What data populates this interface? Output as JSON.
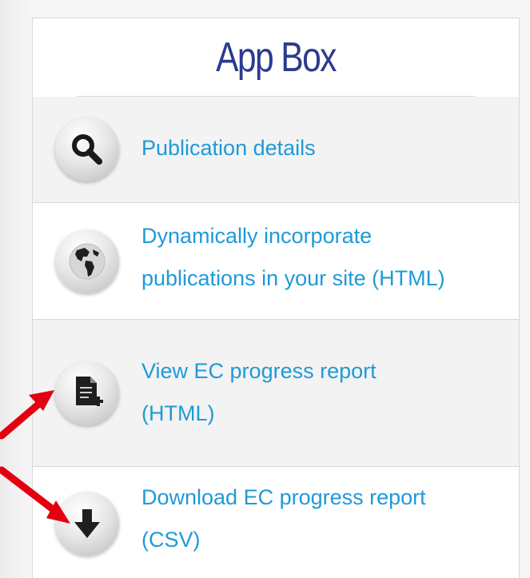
{
  "app_box": {
    "title": "App Box",
    "items": [
      {
        "label": "Publication details",
        "icon": "magnifier-icon"
      },
      {
        "label_line1": "Dynamically incorporate",
        "label_line2": "publications in your site (HTML)",
        "icon": "globe-icon"
      },
      {
        "label_line1": "View EC progress report",
        "label_line2": "(HTML)",
        "icon": "document-add-icon"
      },
      {
        "label_line1": "Download EC progress report",
        "label_line2": "(CSV)",
        "icon": "download-arrow-icon"
      }
    ]
  },
  "colors": {
    "title": "#2c3a8e",
    "link": "#1e9ad8",
    "annotation_arrow": "#e3000f"
  }
}
